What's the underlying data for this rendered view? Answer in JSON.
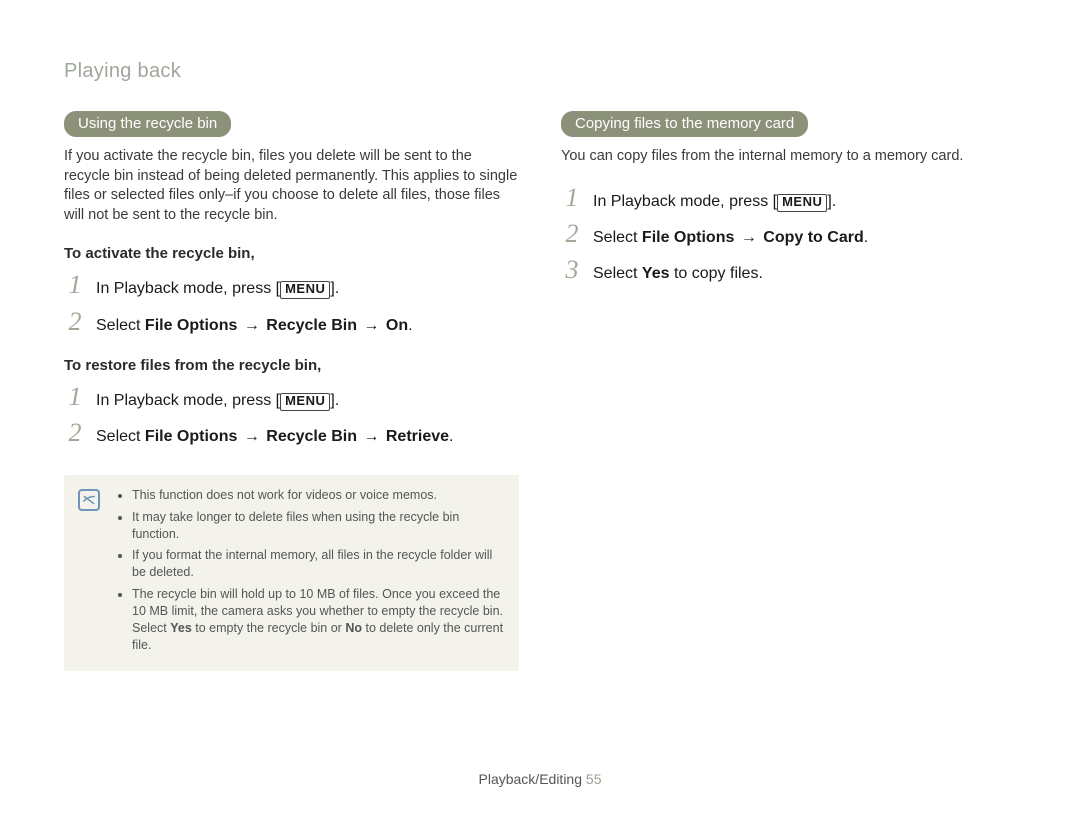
{
  "breadcrumb": "Playing back",
  "left": {
    "pill": "Using the recycle bin",
    "desc": "If you activate the recycle bin, files you delete will be sent to the recycle bin instead of being deleted permanently. This applies to single files or selected files only–if you choose to delete all files, those files will not be sent to the recycle bin.",
    "sub1_head": "To activate the recycle bin,",
    "sub1_steps": {
      "s1_pre": "In Playback mode, press [",
      "s1_menu": "MENU",
      "s1_post": "].",
      "s2_pre": "Select ",
      "s2_b1": "File Options",
      "s2_arr1": " → ",
      "s2_b2": "Recycle Bin",
      "s2_arr2": " → ",
      "s2_b3": "On",
      "s2_post": "."
    },
    "sub2_head": "To restore files from the recycle bin,",
    "sub2_steps": {
      "s1_pre": "In Playback mode, press [",
      "s1_menu": "MENU",
      "s1_post": "].",
      "s2_pre": "Select ",
      "s2_b1": "File Options",
      "s2_arr1": " → ",
      "s2_b2": "Recycle Bin",
      "s2_arr2": " → ",
      "s2_b3": "Retrieve",
      "s2_post": "."
    },
    "notes": {
      "n1": "This function does not work for videos or voice memos.",
      "n2": "It may take longer to delete files when using the recycle bin function.",
      "n3": "If you format the internal memory, all files in the recycle folder will be deleted.",
      "n4_pre": "The recycle bin will hold up to 10 MB of files. Once you exceed the 10 MB limit, the camera asks you whether to empty the recycle bin. Select ",
      "n4_b1": "Yes",
      "n4_mid": " to empty the recycle bin or ",
      "n4_b2": "No",
      "n4_post": " to delete only the current file."
    }
  },
  "right": {
    "pill": "Copying files to the memory card",
    "desc": "You can copy files from the internal memory to a memory card.",
    "steps": {
      "s1_pre": "In Playback mode, press [",
      "s1_menu": "MENU",
      "s1_post": "].",
      "s2_pre": "Select ",
      "s2_b1": "File Options",
      "s2_arr1": " → ",
      "s2_b2": "Copy to Card",
      "s2_post": ".",
      "s3_pre": "Select ",
      "s3_b1": "Yes",
      "s3_post": " to copy files."
    }
  },
  "nums": {
    "n1": "1",
    "n2": "2",
    "n3": "3"
  },
  "footer": {
    "section": "Playback/Editing ",
    "page": " 55"
  }
}
